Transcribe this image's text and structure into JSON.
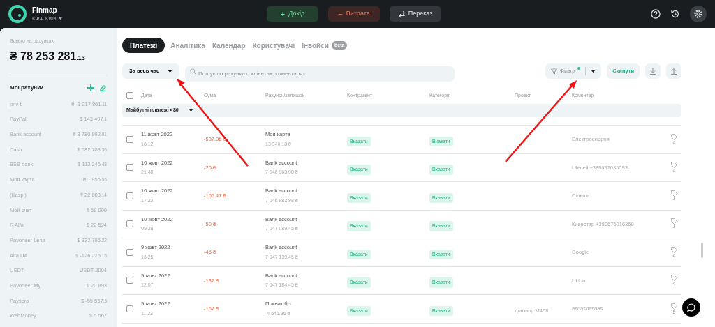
{
  "header": {
    "app_name": "Finmap",
    "company": "КФФ Київ",
    "actions": [
      {
        "kind": "income",
        "icon": "+",
        "label": "Дохід"
      },
      {
        "kind": "expense",
        "icon": "−",
        "label": "Витрата"
      },
      {
        "kind": "transfer",
        "icon": "⇄",
        "label": "Переказ"
      }
    ]
  },
  "sidebar": {
    "total_label": "Всього на рахунках",
    "total": "₴ 78 253 281",
    "total_cents": ".13",
    "accounts_title": "Мої рахунки",
    "accounts": [
      {
        "name": "priv b",
        "amount": "₴ -1 217 861",
        "cents": ".11"
      },
      {
        "name": "PayPal",
        "amount": "$ 143 497",
        "cents": ".1"
      },
      {
        "name": "Bank account",
        "amount": "₴ 8 780 992",
        "cents": ".01"
      },
      {
        "name": "Cash",
        "amount": "$ 582 708",
        "cents": ".36"
      },
      {
        "name": "BSB bank",
        "amount": "$ 112 246",
        "cents": ".48"
      },
      {
        "name": "Моя карта",
        "amount": "₴ 1 955",
        "cents": ".55"
      },
      {
        "name": "(Kaspi)",
        "amount": "₸ 22 008",
        "cents": ".14"
      },
      {
        "name": "Мой счет",
        "amount": "₸ 58 000"
      },
      {
        "name": "R Alfa",
        "amount": "$ 22 524"
      },
      {
        "name": "Payoneer Lena",
        "amount": "$ 832 795",
        "cents": ".22"
      },
      {
        "name": "Alfa UA",
        "amount": "$ -126 225",
        "cents": ".15"
      },
      {
        "name": "USDT",
        "amount": "USDT 2004"
      },
      {
        "name": "Payoneer My",
        "amount": "$ 20 893"
      },
      {
        "name": "Paysera",
        "amount": "$ -55 557",
        "cents": ".5"
      },
      {
        "name": "WebMoney",
        "amount": "$ 5 567"
      }
    ]
  },
  "tabs": [
    {
      "label": "Платежі",
      "selected": true
    },
    {
      "label": "Аналітика",
      "selected": false
    },
    {
      "label": "Календар",
      "selected": false
    },
    {
      "label": "Користувачі",
      "selected": false
    },
    {
      "label": "Інвойси",
      "badge": "beta",
      "selected": false
    }
  ],
  "toolbar": {
    "period": "За весь час",
    "search_placeholder": "Пошук по рахунках, клієнтах, коментарях",
    "filter": "Фільтр",
    "filter_active": true,
    "reset": "Скинути"
  },
  "table": {
    "columns": [
      "Дата",
      "Сума",
      "Рахунок/залишок",
      "Контрагент",
      "Категорія",
      "Проект",
      "Коментар"
    ],
    "select_all_checked": false,
    "group": "Майбутні платежі • 86",
    "rows": [
      {
        "date": "11 жовт 2022",
        "time": "16:12",
        "amount": "-537.36 ₴",
        "account": "Моя карта",
        "balance": "13 340.18 ₴",
        "counterparty": "Вказати",
        "category": "Вказати",
        "comment": "Електроенергія",
        "tags": "4",
        "checked": false
      },
      {
        "date": "10 жовт 2022",
        "time": "21:48",
        "amount": "-20 ₴",
        "account": "Bank account",
        "balance": "7 046 963.98 ₴",
        "counterparty": "Вказати",
        "category": "Вказати",
        "comment": "Lifecell +380931035093",
        "tags": "4",
        "checked": false
      },
      {
        "date": "10 жовт 2022",
        "time": "17:22",
        "amount": "-105.47 ₴",
        "account": "Bank account",
        "balance": "7 046 983.98 ₴",
        "counterparty": "Вказати",
        "category": "Вказати",
        "comment": "Сільпо",
        "tags": "4",
        "checked": false
      },
      {
        "date": "10 жовт 2022",
        "time": "09:38",
        "amount": "-50 ₴",
        "account": "Bank account",
        "balance": "7 047 089.45 ₴",
        "counterparty": "Вказати",
        "category": "Вказати",
        "comment": "Киевстар +380676016359",
        "tags": "4",
        "checked": false
      },
      {
        "date": "9 жовт 2022",
        "time": "16:25",
        "amount": "-45 ₴",
        "account": "Bank account",
        "balance": "7 047 139.45 ₴",
        "counterparty": "Вказати",
        "category": "Вказати",
        "comment": "Google",
        "tags": "4",
        "checked": false
      },
      {
        "date": "9 жовт 2022",
        "time": "12:07",
        "amount": "-137 ₴",
        "account": "Bank account",
        "balance": "7 047 184.45 ₴",
        "counterparty": "Вказати",
        "category": "Вказати",
        "comment": "Uklon",
        "tags": "4",
        "checked": false
      },
      {
        "date": "9 жовт 2022",
        "time": "11:23",
        "amount": "-167 ₴",
        "account": "Приват біз",
        "balance": "-4 541.36 ₴",
        "counterparty": "Вказати",
        "category": "Вказати",
        "project": "договор M458",
        "comment": "asdasdasdas",
        "tags": "5",
        "checked": false
      }
    ]
  }
}
